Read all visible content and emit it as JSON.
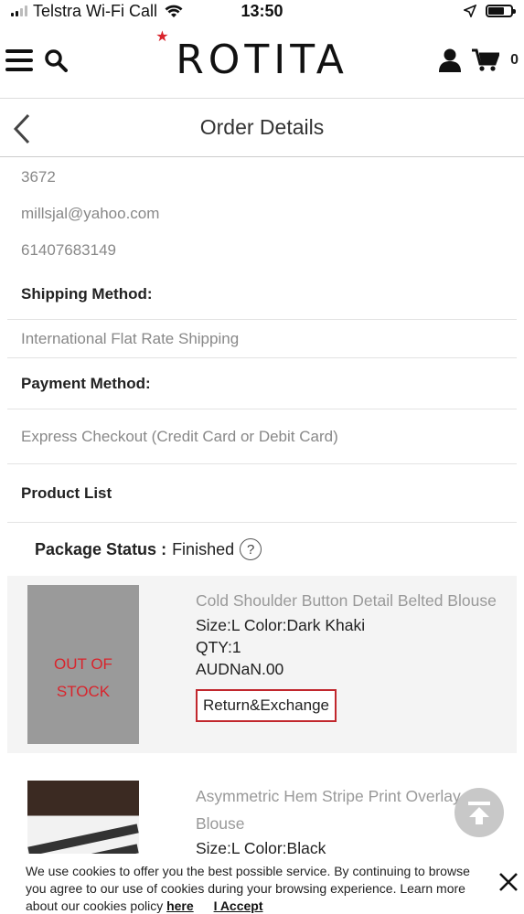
{
  "status_bar": {
    "carrier": "Telstra Wi-Fi Call",
    "time": "13:50",
    "battery_level": 0.7
  },
  "header": {
    "logo": "ROTITA",
    "cart_count": "0"
  },
  "title_bar": {
    "title": "Order Details"
  },
  "contact": {
    "code": "3672",
    "email": "millsjal@yahoo.com",
    "phone": "61407683149"
  },
  "shipping": {
    "label": "Shipping Method:",
    "value": "International Flat Rate Shipping"
  },
  "payment": {
    "label": "Payment Method:",
    "value": "Express Checkout (Credit Card or Debit Card)"
  },
  "product_list": {
    "label": "Product List",
    "package_status_label": "Package Status :",
    "package_status_value": "Finished",
    "help_glyph": "?",
    "items": [
      {
        "name": "Cold Shoulder Button Detail Belted Blouse",
        "size_color": "Size:L Color:Dark Khaki",
        "qty": "QTY:1",
        "price": "AUDNaN.00",
        "badge_line1": "OUT OF",
        "badge_line2": "STOCK",
        "button": "Return&Exchange"
      },
      {
        "name": "Asymmetric Hem Stripe Print Overlay Blouse",
        "size_color": "Size:L Color:Black"
      }
    ]
  },
  "cookie_banner": {
    "text": "We use cookies to offer you the best possible service. By continuing to browse you agree to our use of cookies during your browsing experience. Learn more about our cookies policy",
    "link": "here",
    "accept": "I Accept"
  },
  "colors": {
    "accent": "#d9242c",
    "button_border": "#c1272d"
  }
}
